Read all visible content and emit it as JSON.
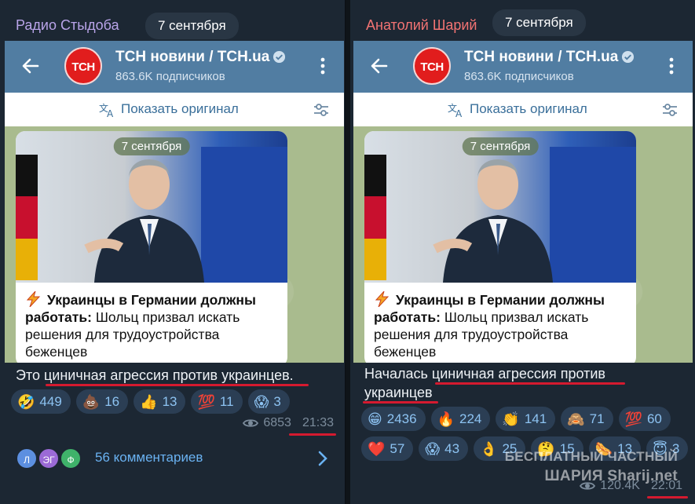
{
  "left": {
    "sender": "Радио Стыдоба",
    "date": "7 сентября",
    "channel": {
      "avatar_text": "ТСН",
      "title": "ТСН новини / TCH.ua",
      "subscribers": "863.6K подписчиков"
    },
    "translate_label": "Показать оригинал",
    "card_date": "7 сентября",
    "post_bold": "Украинцы в Германии должны работать:",
    "post_rest": " Шольц призвал искать решения для трудоустройства беженцев",
    "comment": "Это циничная агрессия против украинцев.",
    "reactions": [
      {
        "emoji": "🤣",
        "count": "449"
      },
      {
        "emoji": "💩",
        "count": "16"
      },
      {
        "emoji": "👍",
        "count": "13"
      },
      {
        "emoji": "💯",
        "count": "11"
      },
      {
        "emoji": "😱",
        "count": "3"
      }
    ],
    "views": "6853",
    "time": "21:33",
    "comment_avatars": [
      "Л",
      "ЭГ",
      "Ф"
    ],
    "comments_label": "56 комментариев"
  },
  "right": {
    "sender": "Анатолий Шарий",
    "date": "7 сентября",
    "channel": {
      "avatar_text": "ТСН",
      "title": "ТСН новини / TCH.ua",
      "subscribers": "863.6K подписчиков"
    },
    "translate_label": "Показать оригинал",
    "card_date": "7 сентября",
    "post_bold": "Украинцы в Германии должны работать:",
    "post_rest": " Шольц призвал искать решения для трудоустройства беженцев",
    "comment": "Началась циничная агрессия против украинцев",
    "reactions": [
      {
        "emoji": "😁",
        "count": "2436"
      },
      {
        "emoji": "🔥",
        "count": "224"
      },
      {
        "emoji": "👏",
        "count": "141"
      },
      {
        "emoji": "🙈",
        "count": "71"
      },
      {
        "emoji": "💯",
        "count": "60"
      },
      {
        "emoji": "❤️",
        "count": "57"
      },
      {
        "emoji": "😱",
        "count": "43"
      },
      {
        "emoji": "👌",
        "count": "25"
      },
      {
        "emoji": "🤔",
        "count": "15"
      },
      {
        "emoji": "🌭",
        "count": "13"
      },
      {
        "emoji": "😇",
        "count": "3"
      }
    ],
    "views": "120.4K",
    "time": "22:01",
    "watermark_line1": "БЕСПЛАТНЫЙ ЧАСТНЫЙ",
    "watermark_line2": "ШАРИЯ Sharij.net"
  },
  "colors": {
    "bg": "#1c2733",
    "header": "#517da2",
    "reaction_bg": "#2b3e54",
    "reaction_text": "#8dc3f2",
    "underline": "#d51a2f"
  }
}
